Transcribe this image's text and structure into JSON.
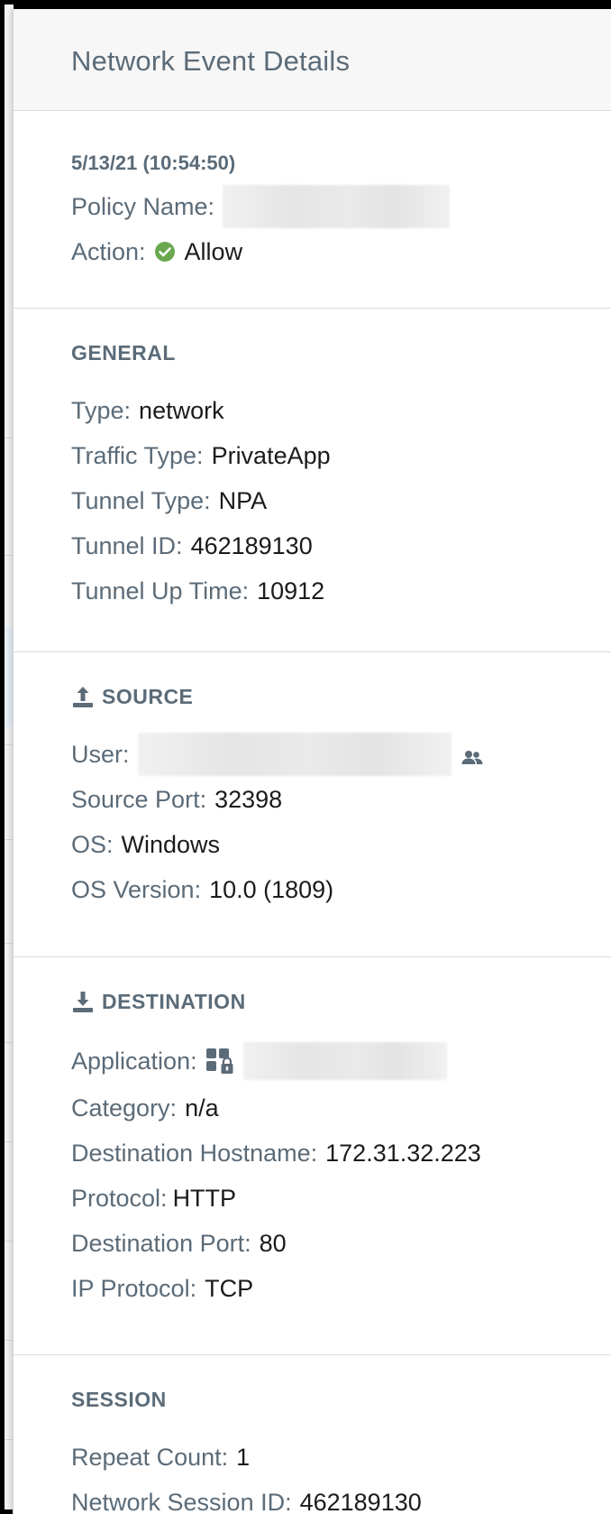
{
  "panel": {
    "title": "Network Event Details"
  },
  "summary": {
    "timestamp": "5/13/21 (10:54:50)",
    "policy_name_label": "Policy Name:",
    "action_label": "Action:",
    "action_value": "Allow",
    "action_icon": "check-circle-icon",
    "action_color": "#6aa84f"
  },
  "general": {
    "heading": "GENERAL",
    "rows": [
      {
        "label": "Type:",
        "value": "network"
      },
      {
        "label": "Traffic Type:",
        "value": "PrivateApp"
      },
      {
        "label": "Tunnel Type:",
        "value": "NPA"
      },
      {
        "label": "Tunnel ID:",
        "value": "462189130"
      },
      {
        "label": "Tunnel Up Time:",
        "value": "10912"
      }
    ]
  },
  "source": {
    "heading": "SOURCE",
    "heading_icon": "upload-icon",
    "user_label": "User:",
    "user_icon": "user-group-icon",
    "rows": [
      {
        "label": "Source Port:",
        "value": "32398"
      },
      {
        "label": "OS:",
        "value": "Windows"
      },
      {
        "label": "OS Version:",
        "value": "10.0 (1809)"
      }
    ]
  },
  "destination": {
    "heading": "DESTINATION",
    "heading_icon": "download-icon",
    "application_label": "Application:",
    "application_icon": "private-app-lock-icon",
    "rows": [
      {
        "label": "Category:",
        "value": "n/a"
      },
      {
        "label": "Destination Hostname:",
        "value": "172.31.32.223"
      },
      {
        "label": "Protocol:",
        "value": "HTTP"
      },
      {
        "label": "Destination Port:",
        "value": "80"
      },
      {
        "label": "IP Protocol:",
        "value": "TCP"
      }
    ]
  },
  "session": {
    "heading": "SESSION",
    "rows": [
      {
        "label": "Repeat Count:",
        "value": "1"
      },
      {
        "label": "Network Session ID:",
        "value": "462189130"
      }
    ]
  },
  "colors": {
    "label": "#5b6b78",
    "value": "#1b1b1b",
    "header_bg": "#f7f7f7",
    "divider": "#d8dcdf"
  }
}
